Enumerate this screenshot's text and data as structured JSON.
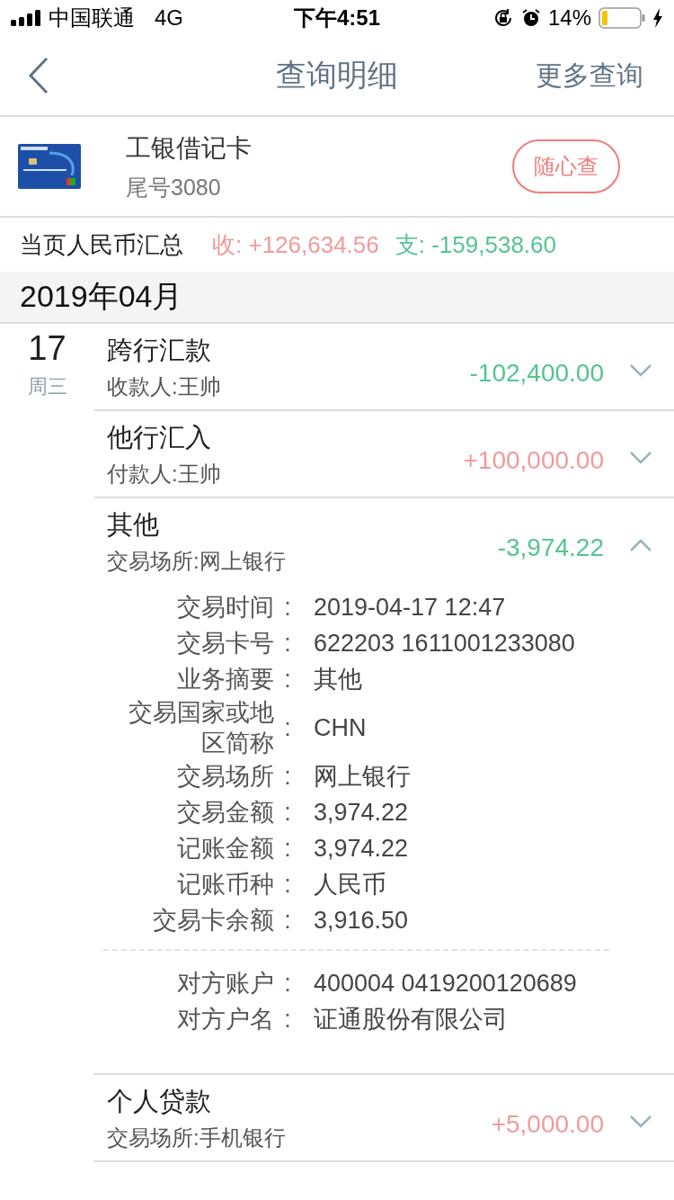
{
  "status_bar": {
    "carrier": "中国联通",
    "network": "4G",
    "time": "下午4:51",
    "battery": "14%"
  },
  "nav": {
    "title": "查询明细",
    "action": "更多查询"
  },
  "account": {
    "name": "工银借记卡",
    "tail": "尾号3080",
    "button": "随心查"
  },
  "summary": {
    "label": "当页人民币汇总",
    "income": "收: +126,634.56",
    "expense": "支: -159,538.60"
  },
  "month": "2019年04月",
  "days": [
    {
      "day": "17",
      "weekday": "周三",
      "transactions": [
        {
          "title": "跨行汇款",
          "subtitle": "收款人:王帅",
          "amount": "-102,400.00",
          "kind": "expense",
          "expanded": false
        },
        {
          "title": "他行汇入",
          "subtitle": "付款人:王帅",
          "amount": "+100,000.00",
          "kind": "income",
          "expanded": false
        },
        {
          "title": "其他",
          "subtitle": "交易场所:网上银行",
          "amount": "-3,974.22",
          "kind": "expense",
          "expanded": true,
          "details": [
            {
              "label": "交易时间",
              "separator": ":",
              "value": "2019-04-17 12:47"
            },
            {
              "label": "交易卡号",
              "separator": ":",
              "value": "622203 1611001233080"
            },
            {
              "label": "业务摘要",
              "separator": ":",
              "value": "其他"
            },
            {
              "label": "交易国家或地区简称",
              "separator": ":",
              "value": "CHN"
            },
            {
              "label": "交易场所",
              "separator": ":",
              "value": "网上银行"
            },
            {
              "label": "交易金额",
              "separator": ":",
              "value": "3,974.22"
            },
            {
              "label": "记账金额",
              "separator": ":",
              "value": "3,974.22"
            },
            {
              "label": "记账币种",
              "separator": ":",
              "value": "人民币"
            },
            {
              "label": "交易卡余额",
              "separator": ":",
              "value": "3,916.50"
            }
          ],
          "counterparty": [
            {
              "label": "对方账户",
              "separator": ":",
              "value": "400004 0419200120689"
            },
            {
              "label": "对方户名",
              "separator": ":",
              "value": "证通股份有限公司"
            }
          ]
        },
        {
          "title": "个人贷款",
          "subtitle": "交易场所:手机银行",
          "amount": "+5,000.00",
          "kind": "income",
          "expanded": false
        }
      ]
    }
  ]
}
